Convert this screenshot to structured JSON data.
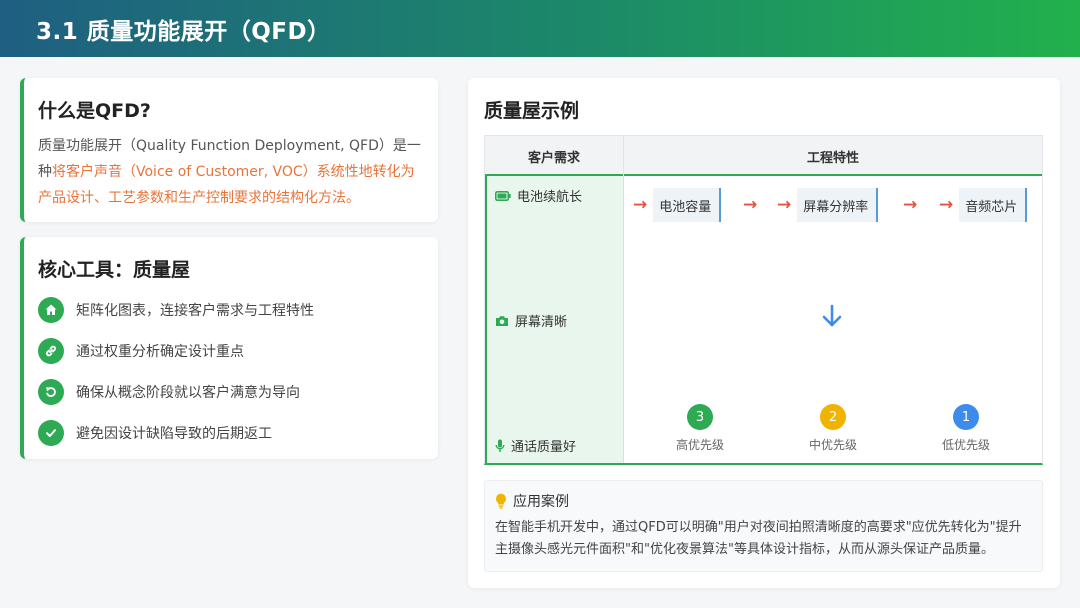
{
  "header": {
    "title": "3.1 质量功能展开（QFD）"
  },
  "what_is": {
    "title": "什么是QFD?",
    "text_part1": "质量功能展开（Quality Function Deployment, QFD）是一种",
    "text_highlight": "将客户声音（Voice of Customer, VOC）系统性地转化为产品设计、工艺参数和生产控制要求的结构化方法。"
  },
  "core_tool": {
    "title": "核心工具：质量屋",
    "items": [
      {
        "icon": "home-icon",
        "label": "矩阵化图表，连接客户需求与工程特性"
      },
      {
        "icon": "link-icon",
        "label": "通过权重分析确定设计重点"
      },
      {
        "icon": "undo-icon",
        "label": "确保从概念阶段就以客户满意为导向"
      },
      {
        "icon": "check-icon",
        "label": "避免因设计缺陷导致的后期返工"
      }
    ]
  },
  "house": {
    "title": "质量屋示例",
    "col_customer": "客户需求",
    "col_engineering": "工程特性",
    "requirements": [
      {
        "icon": "battery-icon",
        "label": "电池续航长"
      },
      {
        "icon": "camera-icon",
        "label": "屏幕清晰"
      },
      {
        "icon": "microphone-icon",
        "label": "通话质量好"
      }
    ],
    "characteristics": [
      "电池容量",
      "屏幕分辨率",
      "音频芯片"
    ],
    "priorities": [
      {
        "num": "3",
        "label": "高优先级",
        "color": "#2eaa55"
      },
      {
        "num": "2",
        "label": "中优先级",
        "color": "#f0b400"
      },
      {
        "num": "1",
        "label": "低优先级",
        "color": "#3d8bea"
      }
    ]
  },
  "case": {
    "title": "应用案例",
    "text": "在智能手机开发中，通过QFD可以明确\"用户对夜间拍照清晰度的高要求\"应优先转化为\"提升主摄像头感光元件面积\"和\"优化夜景算法\"等具体设计指标，从而从源头保证产品质量。"
  },
  "colors": {
    "accent": "#2eaa55",
    "highlight": "#e8743a",
    "arrow": "#e5533f",
    "down_arrow": "#3d8bea"
  }
}
